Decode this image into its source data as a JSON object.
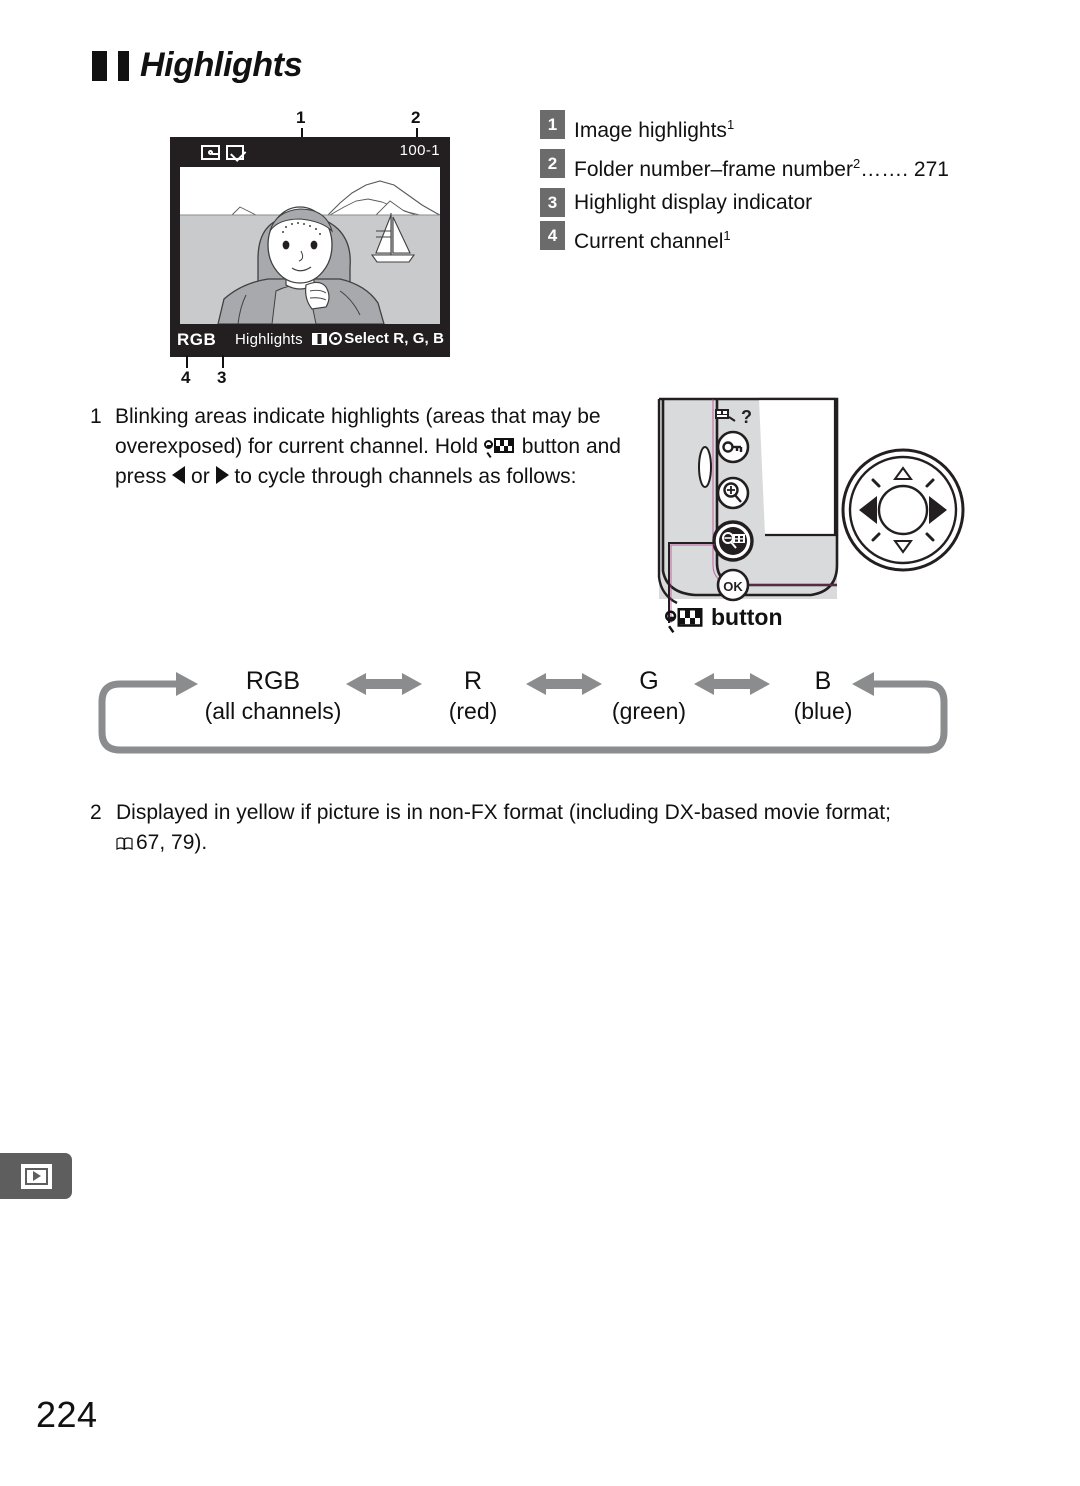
{
  "page": {
    "number": "224",
    "tab_icon": "playback-icon"
  },
  "heading": {
    "text": "Highlights",
    "marker_icon": "section-square-marker"
  },
  "lcd": {
    "icons": [
      "protect-key-icon",
      "retouch-icon"
    ],
    "frame_number": "100-1",
    "channel_label": "RGB",
    "mode_label": "Highlights",
    "hint_label": "Select R, G, B",
    "hint_icons": [
      "thumbnail-icon",
      "multi-selector-icon"
    ],
    "callouts_top": [
      "1",
      "2"
    ],
    "callouts_bottom": [
      "4",
      "3"
    ]
  },
  "legend": [
    {
      "num": "1",
      "label": "Image highlights",
      "sup": "1",
      "dots": "",
      "page": ""
    },
    {
      "num": "2",
      "label": "Folder number–frame number",
      "sup": "2",
      "dots": "…….",
      "page": "271"
    },
    {
      "num": "3",
      "label": "Highlight display indicator",
      "sup": "",
      "dots": "",
      "page": ""
    },
    {
      "num": "4",
      "label": "Current channel",
      "sup": "1",
      "dots": "",
      "page": ""
    }
  ],
  "step1": {
    "number": "1",
    "part_a": "Blinking areas indicate highlights (areas that may be overexposed) for current channel.  Hold",
    "part_b": "button and press",
    "part_c": "or",
    "part_d": "to cycle through channels as follows:",
    "icon_hold": "zoom-out-thumbnail-icon",
    "icon_left": "left-arrow-icon",
    "icon_right": "right-arrow-icon"
  },
  "camera_diagram": {
    "button_label": "button",
    "button_icon": "zoom-out-thumbnail-icon",
    "body_buttons": [
      "delete-icon",
      "help-question-icon",
      "protect-key-icon",
      "zoom-in-icon",
      "zoom-out-thumbnail-icon",
      "ok-button"
    ],
    "multi_selector": "multi-selector-dial"
  },
  "cycle": {
    "items": [
      {
        "top": "RGB",
        "bottom": "(all channels)"
      },
      {
        "top": "R",
        "bottom": "(red)"
      },
      {
        "top": "G",
        "bottom": "(green)"
      },
      {
        "top": "B",
        "bottom": "(blue)"
      }
    ],
    "arrow_icon": "double-arrow-icon",
    "loop_icon": "loop-arrow-path"
  },
  "footnote2": {
    "number": "2",
    "text_a": "Displayed in yellow if picture is in non-FX format (including DX-based movie format;",
    "book_icon": "book-reference-icon",
    "text_b": "67, 79)."
  },
  "colors": {
    "badge_gray": "#6b6b6b",
    "lcd_background": "#231f20",
    "cycle_gray": "#808080",
    "tab_gray": "#5e5e5e",
    "text": "#111111"
  }
}
